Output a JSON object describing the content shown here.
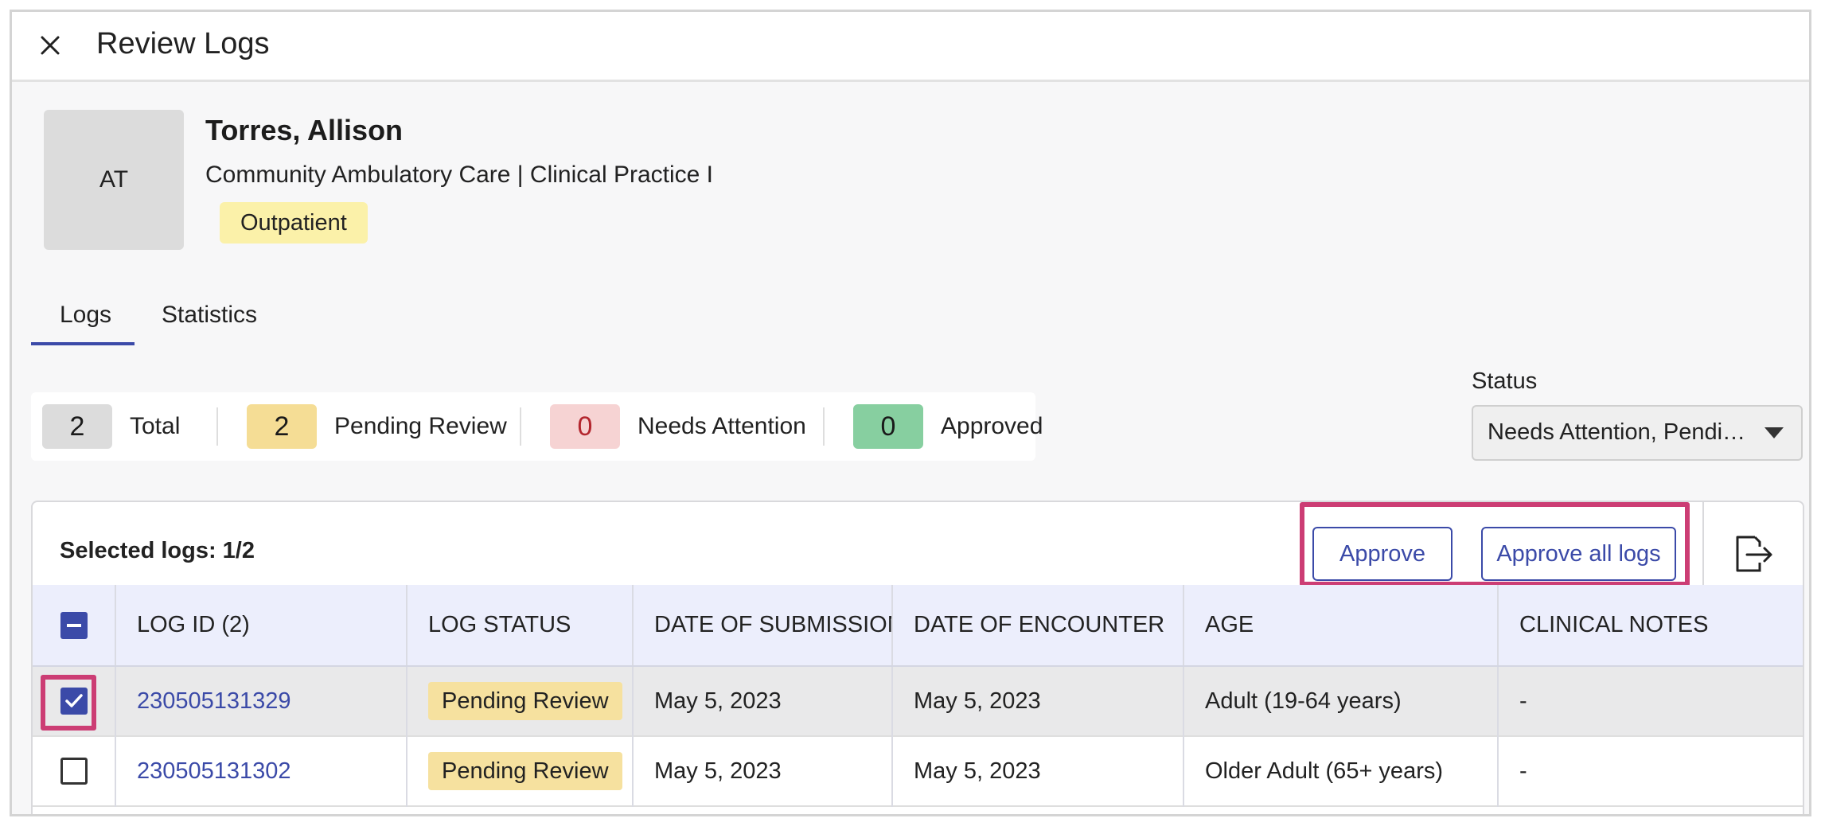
{
  "header": {
    "title": "Review Logs"
  },
  "profile": {
    "initials": "AT",
    "name": "Torres, Allison",
    "program": "Community Ambulatory Care | Clinical Practice I",
    "setting_badge": "Outpatient"
  },
  "tabs": [
    {
      "label": "Logs",
      "active": true
    },
    {
      "label": "Statistics",
      "active": false
    }
  ],
  "summary": {
    "total": {
      "count": "2",
      "label": "Total",
      "color": "#dcdcdc"
    },
    "pending": {
      "count": "2",
      "label": "Pending Review",
      "color": "#f5dd95"
    },
    "attention": {
      "count": "0",
      "label": "Needs Attention",
      "color": "#f6d3d3",
      "text_color": "#b3262e"
    },
    "approved": {
      "count": "0",
      "label": "Approved",
      "color": "#87cfa0"
    }
  },
  "status_filter": {
    "label": "Status",
    "value": "Needs Attention, Pendi…"
  },
  "table_toolbar": {
    "selected_text": "Selected logs: 1/2",
    "approve_label": "Approve",
    "approve_all_label": "Approve all logs"
  },
  "table": {
    "columns": [
      "LOG ID (2)",
      "LOG STATUS",
      "DATE OF SUBMISSION",
      "DATE OF ENCOUNTER",
      "AGE",
      "CLINICAL NOTES"
    ],
    "rows": [
      {
        "selected": true,
        "log_id": "230505131329",
        "status": "Pending Review",
        "submitted": "May 5, 2023",
        "encounter": "May 5, 2023",
        "age": "Adult (19-64 years)",
        "notes": "-"
      },
      {
        "selected": false,
        "log_id": "230505131302",
        "status": "Pending Review",
        "submitted": "May 5, 2023",
        "encounter": "May 5, 2023",
        "age": "Older Adult (65+ years)",
        "notes": "-"
      }
    ]
  },
  "colors": {
    "accent": "#3b4aa8",
    "highlight": "#cc3d74",
    "badge_outpatient": "#fbf1a9",
    "pill_pending": "#f6e19f"
  }
}
